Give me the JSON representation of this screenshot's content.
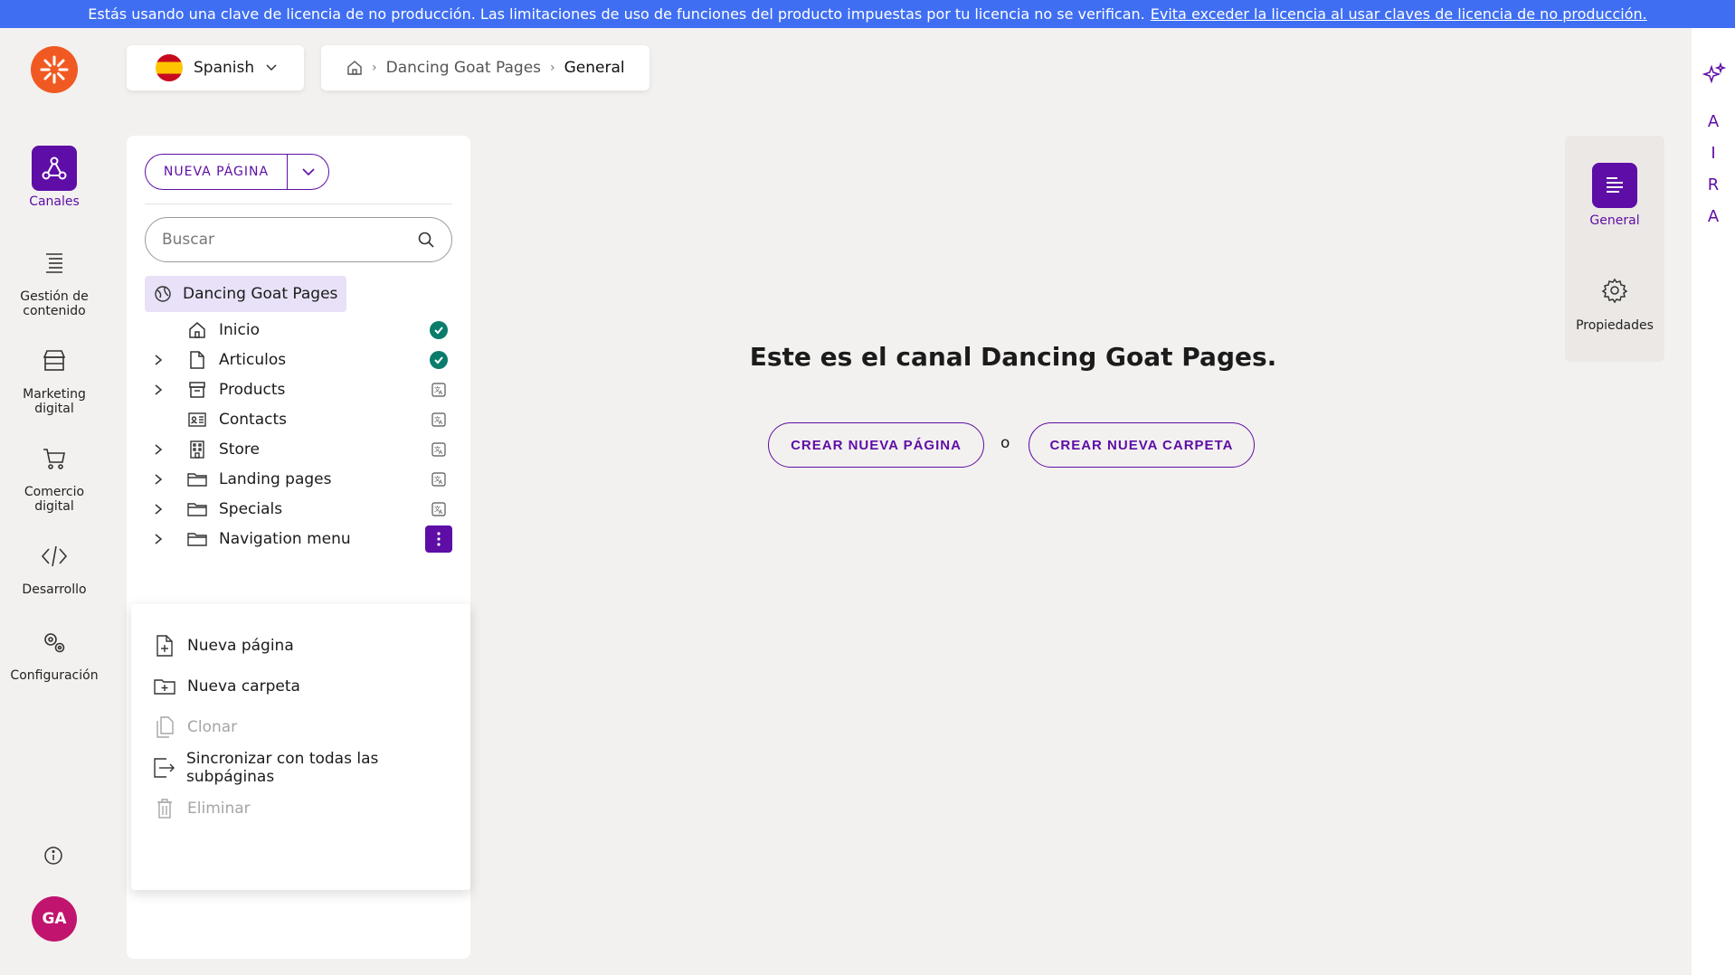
{
  "banner": {
    "message": "Estás usando una clave de licencia de no producción. Las limitaciones de uso de funciones del producto impuestas por tu licencia no se verifican.",
    "link": "Evita exceder la licencia al usar claves de licencia de no producción."
  },
  "leftnav": {
    "items": [
      {
        "label": "Canales"
      },
      {
        "label": "Gestión de contenido"
      },
      {
        "label": "Marketing digital"
      },
      {
        "label": "Comercio digital"
      },
      {
        "label": "Desarrollo"
      },
      {
        "label": "Configuración"
      }
    ],
    "avatar": "GA"
  },
  "language": {
    "selected": "Spanish"
  },
  "breadcrumb": {
    "channel": "Dancing Goat Pages",
    "current": "General"
  },
  "tree": {
    "new_page_label": "NUEVA PÁGINA",
    "search_placeholder": "Buscar",
    "root": "Dancing Goat Pages",
    "items": [
      {
        "label": "Inicio",
        "status": "published"
      },
      {
        "label": "Articulos",
        "status": "published"
      },
      {
        "label": "Products",
        "status": "untranslated"
      },
      {
        "label": "Contacts",
        "status": "untranslated"
      },
      {
        "label": "Store",
        "status": "untranslated"
      },
      {
        "label": "Landing pages",
        "status": "untranslated"
      },
      {
        "label": "Specials",
        "status": "untranslated"
      },
      {
        "label": "Navigation menu",
        "status": "menu-open"
      }
    ]
  },
  "context_menu": {
    "items": [
      {
        "label": "Nueva página",
        "enabled": true
      },
      {
        "label": "Nueva carpeta",
        "enabled": true
      },
      {
        "label": "Clonar",
        "enabled": false
      },
      {
        "label": "Sincronizar con todas las subpáginas",
        "enabled": true
      },
      {
        "label": "Eliminar",
        "enabled": false
      }
    ]
  },
  "main": {
    "title": "Este es el canal Dancing Goat Pages.",
    "create_page": "CREAR NUEVA PÁGINA",
    "or": "o",
    "create_folder": "CREAR NUEVA CARPETA"
  },
  "right_panel": {
    "items": [
      {
        "label": "General"
      },
      {
        "label": "Propiedades"
      }
    ]
  },
  "aira": {
    "letters": [
      "A",
      "I",
      "R",
      "A"
    ]
  },
  "colors": {
    "accent": "#5e0da6",
    "banner": "#3f6ef2",
    "published": "#0a7c6b",
    "logo": "#f05a22",
    "avatar": "#c0146e"
  }
}
